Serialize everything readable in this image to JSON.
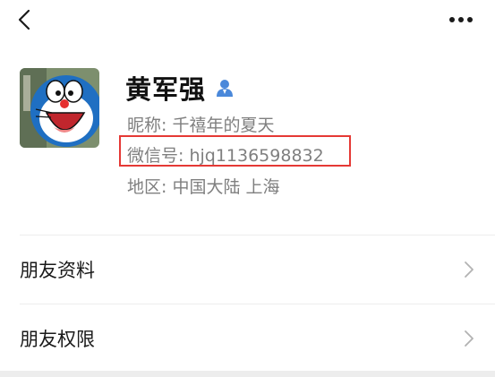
{
  "header": {
    "back_icon": "chevron-left-icon",
    "more_icon": "more-dots-icon"
  },
  "profile": {
    "name": "黄军强",
    "gender_icon": "male-user-icon",
    "gender_color": "#4a88da",
    "nickname": "昵称: 千禧年的夏天",
    "wechat_id": "微信号: hjq1136598832",
    "region": "地区: 中国大陆  上海",
    "highlight_color": "#e53935"
  },
  "menu": {
    "items": [
      {
        "label": "朋友资料"
      },
      {
        "label": "朋友权限"
      }
    ]
  }
}
